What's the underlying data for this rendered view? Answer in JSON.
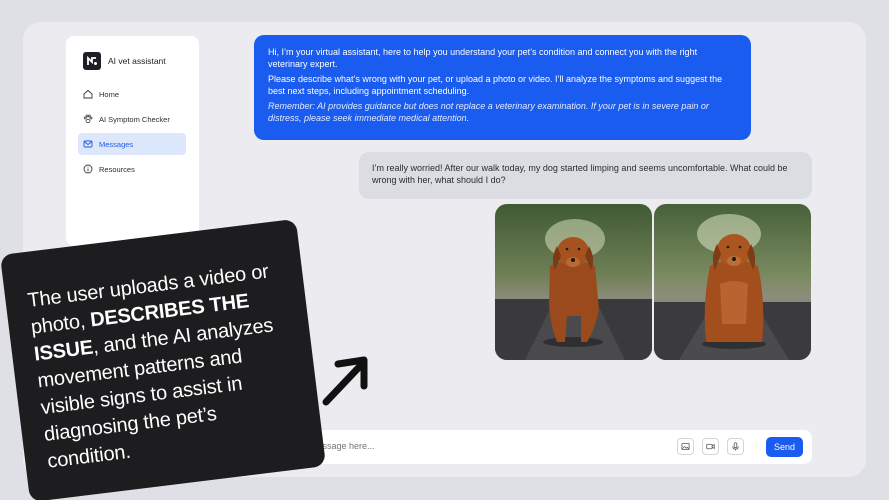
{
  "sidebar": {
    "brand": "AI vet assistant",
    "items": [
      {
        "label": "Home",
        "icon": "home-icon",
        "active": false
      },
      {
        "label": "AI Symptom Checker",
        "icon": "paw-icon",
        "active": false
      },
      {
        "label": "Messages",
        "icon": "message-icon",
        "active": true
      },
      {
        "label": "Resources",
        "icon": "info-icon",
        "active": false
      }
    ]
  },
  "chat": {
    "ai_message": {
      "line1": "Hi, I’m your virtual assistant, here to help you understand your pet’s condition and connect you with the right veterinary expert.",
      "line2": "Please describe what’s wrong with your pet, or upload a photo or video. I’ll analyze the symptoms and suggest the best next steps, including appointment scheduling.",
      "note": "Remember: AI provides guidance but does not replace a veterinary examination. If your pet is in severe pain or distress, please seek immediate medical attention."
    },
    "user_message": "I’m really worried! After our walk today, my dog started limping and seems uncomfortable. What could be wrong with her, what should I do?"
  },
  "composer": {
    "placeholder": "message here...",
    "send_label": "Send"
  },
  "callout": {
    "before": "The user uploads a video or photo, ",
    "emphasis": "DESCRIBES THE ISSUE",
    "after": ", and the AI analyzes movement patterns and visible signs to assist in diagnosing the pet’s condition."
  },
  "colors": {
    "accent": "#1a5bf0",
    "callout_bg": "#1d1d1f",
    "background": "#dfe0e6"
  }
}
